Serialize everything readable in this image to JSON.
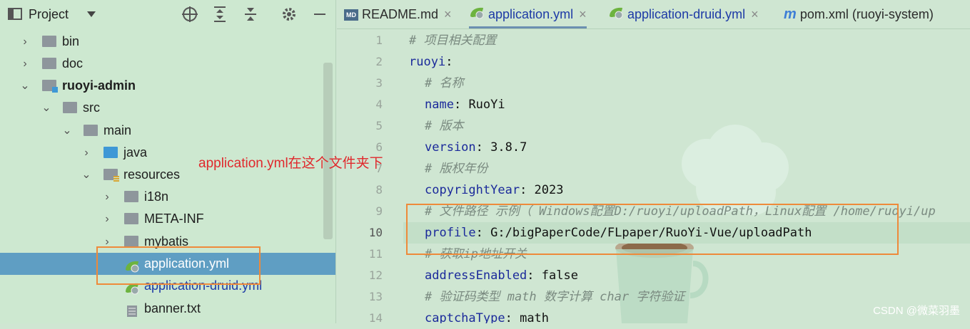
{
  "project": {
    "title": "Project",
    "icons": [
      "target-icon",
      "expand-all-icon",
      "collapse-all-icon",
      "gear-icon",
      "minimize-icon"
    ],
    "tree": [
      {
        "label": "bin",
        "icon": "folder-icon"
      },
      {
        "label": "doc",
        "icon": "folder-icon"
      },
      {
        "label": "ruoyi-admin",
        "icon": "module-icon"
      },
      {
        "label": "src",
        "icon": "folder-icon"
      },
      {
        "label": "main",
        "icon": "folder-icon"
      },
      {
        "label": "java",
        "icon": "source-folder-icon"
      },
      {
        "label": "resources",
        "icon": "resources-folder-icon"
      },
      {
        "label": "i18n",
        "icon": "folder-icon"
      },
      {
        "label": "META-INF",
        "icon": "folder-icon"
      },
      {
        "label": "mybatis",
        "icon": "folder-icon"
      },
      {
        "label": "application.yml",
        "icon": "spring-yaml-icon"
      },
      {
        "label": "application-druid.yml",
        "icon": "spring-yaml-icon"
      },
      {
        "label": "banner.txt",
        "icon": "text-file-icon"
      }
    ]
  },
  "tabs": [
    {
      "label": "README.md",
      "icon": "markdown-icon"
    },
    {
      "label": "application.yml",
      "icon": "spring-yaml-icon"
    },
    {
      "label": "application-druid.yml",
      "icon": "spring-yaml-icon"
    },
    {
      "label": "pom.xml (ruoyi-system)",
      "icon": "maven-icon"
    }
  ],
  "close_glyph": "×",
  "editor": {
    "line_numbers": [
      "1",
      "2",
      "3",
      "4",
      "5",
      "6",
      "7",
      "8",
      "9",
      "10",
      "11",
      "12",
      "13",
      "14"
    ],
    "current_line": "10",
    "lines": [
      {
        "comment": "# 项目相关配置"
      },
      {
        "key": "ruoyi",
        "sep": ":"
      },
      {
        "comment": "# 名称"
      },
      {
        "key": "name",
        "sep": ": ",
        "value": "RuoYi"
      },
      {
        "comment": "# 版本"
      },
      {
        "key": "version",
        "sep": ": ",
        "value": "3.8.7"
      },
      {
        "comment": "# 版权年份"
      },
      {
        "key": "copyrightYear",
        "sep": ": ",
        "value": "2023"
      },
      {
        "comment": "# 文件路径 示例（ Windows配置D:/ruoyi/uploadPath，Linux配置 /home/ruoyi/up"
      },
      {
        "key": "profile",
        "sep": ": ",
        "value": "G:/bigPaperCode/FLpaper/RuoYi-Vue/uploadPath"
      },
      {
        "comment": "# 获取ip地址开关"
      },
      {
        "key": "addressEnabled",
        "sep": ": ",
        "value": "false"
      },
      {
        "comment": "# 验证码类型 math 数字计算 char 字符验证"
      },
      {
        "key": "captchaType",
        "sep": ": ",
        "value": "math"
      }
    ]
  },
  "annotation": "application.yml在这个文件夹下",
  "watermark": "CSDN @微菜羽墨",
  "colors": {
    "highlight_box": "#ee8a3a",
    "annotation_text": "#e0282c",
    "selection": "#5f9ec3"
  }
}
